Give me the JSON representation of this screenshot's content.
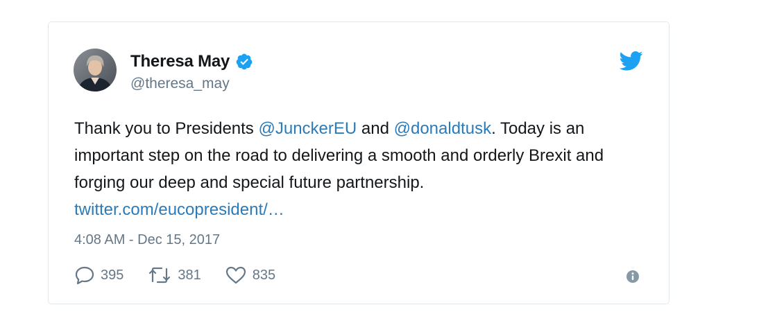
{
  "user": {
    "display_name": "Theresa May",
    "handle": "@theresa_may",
    "verified": true,
    "avatar": "profile-photo"
  },
  "tweet": {
    "segments": [
      {
        "text": "Thank you to Presidents ",
        "link": false
      },
      {
        "text": "@JunckerEU",
        "link": true
      },
      {
        "text": " and ",
        "link": false
      },
      {
        "text": "@donaldtusk",
        "link": true
      },
      {
        "text": ". Today is an important step on the road to delivering a smooth and orderly Brexit and forging our deep and special future partnership. ",
        "link": false
      },
      {
        "text": "twitter.com/eucopresident/…",
        "link": true
      }
    ],
    "timestamp": "4:08 AM - Dec 15, 2017"
  },
  "actions": {
    "replies": "395",
    "retweets": "381",
    "likes": "835"
  },
  "icons": {
    "brand": "twitter-bird-icon",
    "verified": "verified-badge-icon",
    "reply": "reply-icon",
    "retweet": "retweet-icon",
    "like": "heart-icon",
    "info": "info-icon"
  },
  "colors": {
    "twitter_blue": "#1da1f2",
    "link": "#2b7bb9",
    "text": "#14171a",
    "secondary": "#657786",
    "border": "#e1e8ed"
  }
}
